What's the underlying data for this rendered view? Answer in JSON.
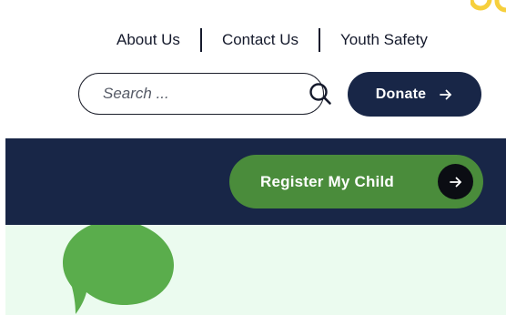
{
  "util_nav": {
    "items": [
      {
        "label": "About Us"
      },
      {
        "label": "Contact Us"
      },
      {
        "label": "Youth Safety"
      }
    ]
  },
  "search": {
    "placeholder": "Search ...",
    "icon": "search-icon"
  },
  "donate": {
    "label": "Donate",
    "icon": "arrow-right-icon"
  },
  "register": {
    "label": "Register My Child",
    "icon": "arrow-right-icon"
  },
  "colors": {
    "navy": "#182647",
    "green": "#4a8c3b",
    "bubble_green": "#5aad4c",
    "mint": "#ebfbef",
    "accent_yellow": "#f6cf3c"
  }
}
